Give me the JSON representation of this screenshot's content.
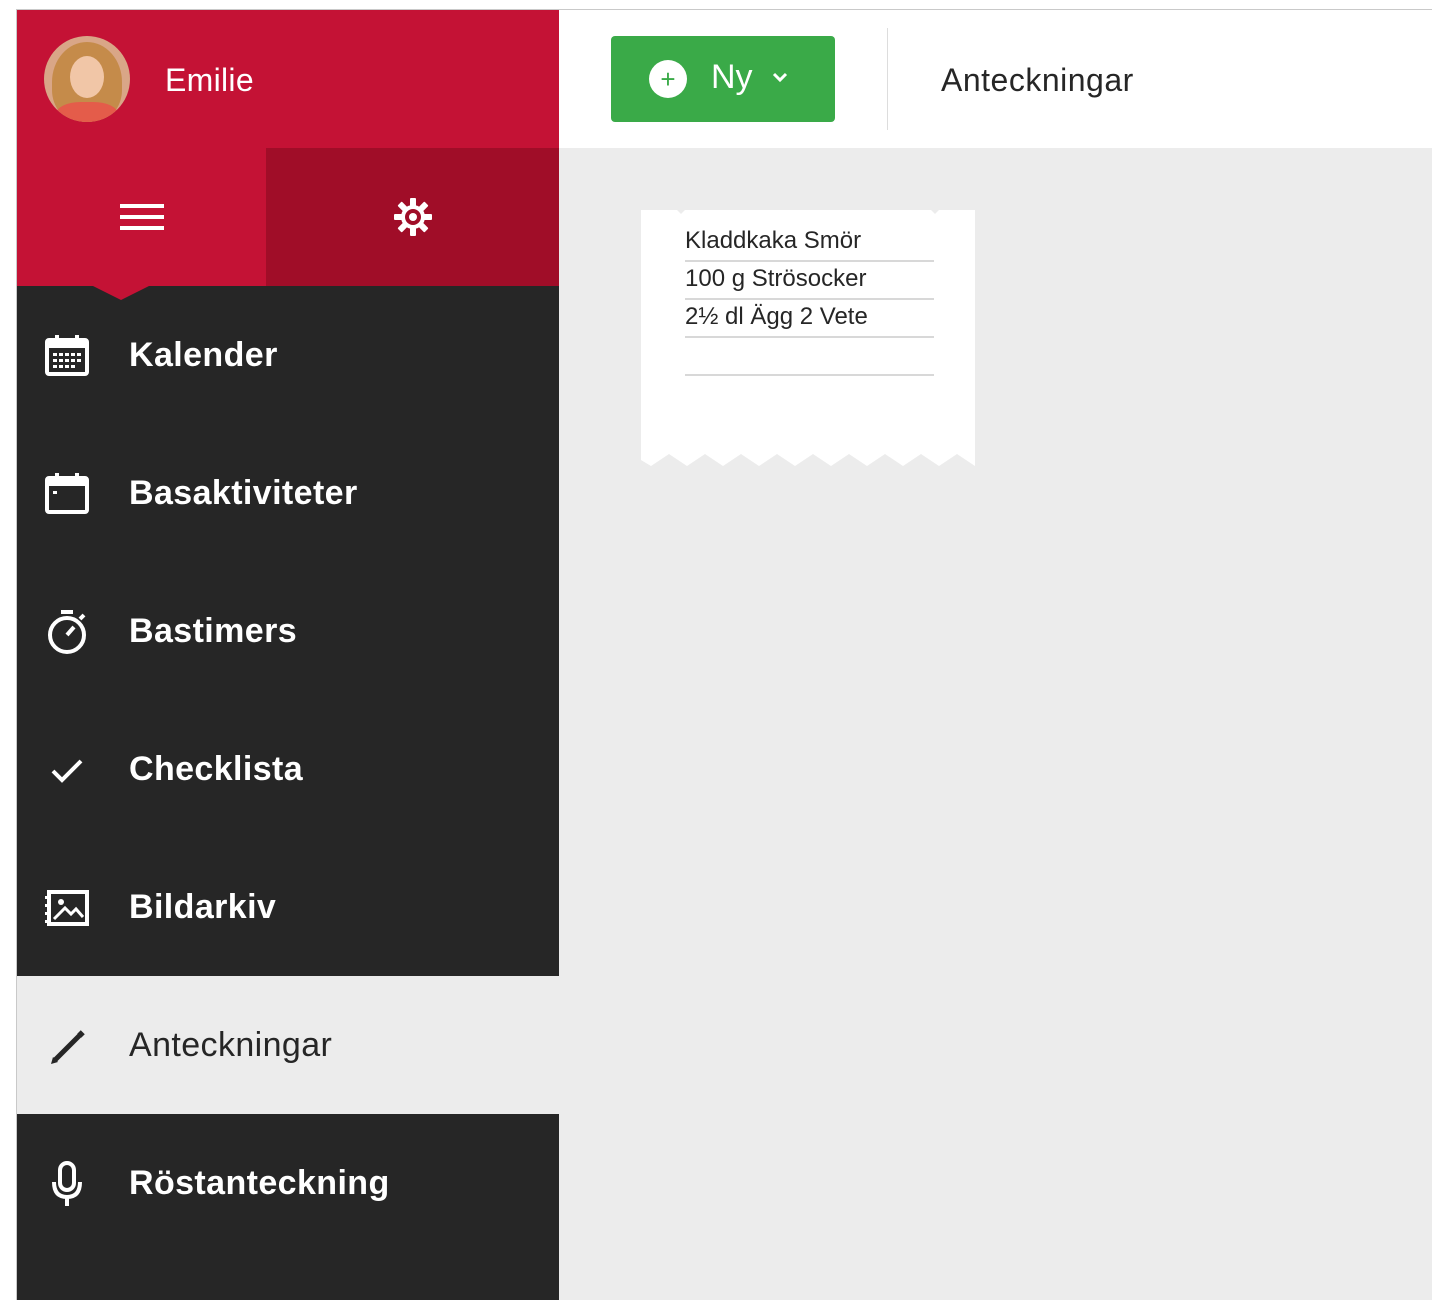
{
  "user": {
    "name": "Emilie"
  },
  "toolbar": {
    "new_button_label": "Ny",
    "page_title": "Anteckningar"
  },
  "sidebar": {
    "items": [
      {
        "label": "Kalender",
        "icon": "calendar-grid-icon",
        "active": false
      },
      {
        "label": "Basaktiviteter",
        "icon": "calendar-icon",
        "active": false
      },
      {
        "label": "Bastimers",
        "icon": "stopwatch-icon",
        "active": false
      },
      {
        "label": "Checklista",
        "icon": "checkmark-icon",
        "active": false
      },
      {
        "label": "Bildarkiv",
        "icon": "image-gallery-icon",
        "active": false
      },
      {
        "label": "Anteckningar",
        "icon": "pencil-icon",
        "active": true
      },
      {
        "label": "Röstanteckning",
        "icon": "microphone-icon",
        "active": false
      }
    ]
  },
  "note": {
    "lines": [
      "Kladdkaka Smör",
      "100 g Strösocker",
      "2½ dl Ägg 2 Vete",
      ""
    ]
  },
  "colors": {
    "brand_red": "#c41235",
    "brand_red_dark": "#a00d28",
    "sidebar_dark": "#262626",
    "green": "#3aaa48",
    "content_bg": "#ececec"
  }
}
